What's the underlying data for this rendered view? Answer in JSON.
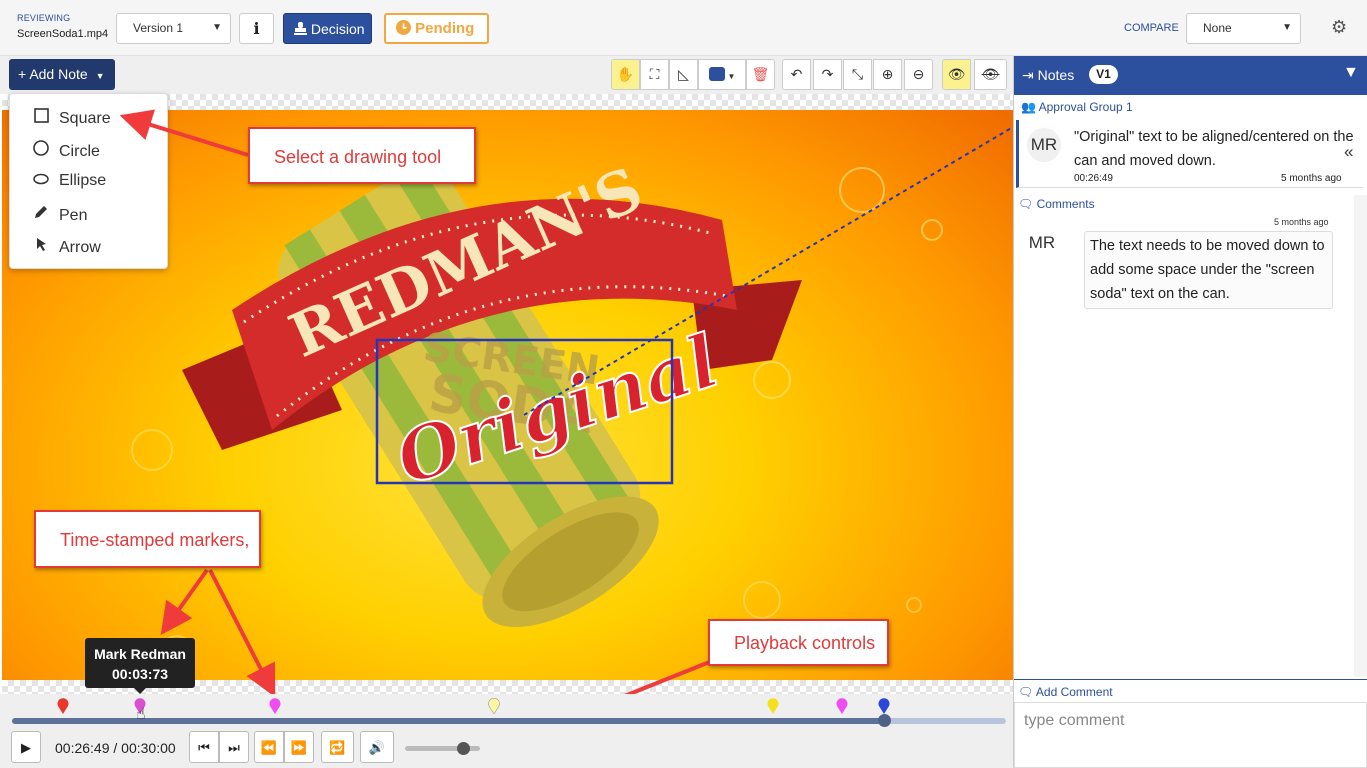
{
  "header": {
    "reviewing_label": "REVIEWING",
    "filename": "ScreenSoda1.mp4",
    "version_select": "Version 1",
    "info_label": "i",
    "decision_label": "Decision",
    "pending_label": "Pending",
    "compare_label": "COMPARE",
    "compare_select": "None"
  },
  "toolbar": {
    "add_note_label": "Add Note",
    "tools": [
      {
        "name": "pan-tool-button",
        "icon": "hand-icon",
        "active": true
      },
      {
        "name": "crop-tool-button",
        "icon": "crop-icon",
        "active": false
      },
      {
        "name": "measure-tool-button",
        "icon": "ruler-icon",
        "active": false
      },
      {
        "name": "color-picker-button",
        "icon": "palette-icon",
        "active": false
      },
      {
        "name": "delete-button",
        "icon": "trash-icon",
        "active": false
      },
      {
        "name": "undo-button",
        "icon": "undo-icon",
        "active": false
      },
      {
        "name": "redo-button",
        "icon": "redo-icon",
        "active": false
      },
      {
        "name": "fit-button",
        "icon": "expand-icon",
        "active": false
      },
      {
        "name": "zoom-in-button",
        "icon": "zoom-in-icon",
        "active": false
      },
      {
        "name": "zoom-out-button",
        "icon": "zoom-out-icon",
        "active": false
      },
      {
        "name": "show-annotations-button",
        "icon": "eye-icon",
        "active": true
      },
      {
        "name": "hide-annotations-button",
        "icon": "eye-off-icon",
        "active": false
      }
    ]
  },
  "draw_menu": {
    "items": [
      {
        "label": "Square",
        "icon": "square-icon"
      },
      {
        "label": "Circle",
        "icon": "circle-icon"
      },
      {
        "label": "Ellipse",
        "icon": "ellipse-icon"
      },
      {
        "label": "Pen",
        "icon": "pen-icon"
      },
      {
        "label": "Arrow",
        "icon": "cursor-arrow-icon"
      }
    ]
  },
  "video": {
    "brand_text": "REDMAN'S",
    "can_text_1": "SCREEN",
    "can_text_2": "SODA",
    "script_text": "Original"
  },
  "callouts": {
    "drawing_tool": "Select a drawing tool",
    "markers": "Time-stamped markers,",
    "playback": "Playback controls"
  },
  "tooltip": {
    "name": "Mark Redman",
    "time": "00:03:73"
  },
  "timeline": {
    "progress_fraction": 0.877,
    "markers": [
      {
        "color": "#e8382d"
      },
      {
        "color": "#d84fd0"
      },
      {
        "color": "#f04df0"
      },
      {
        "color": "#fff7a0"
      },
      {
        "color": "#f5e020"
      },
      {
        "color": "#f04df0"
      },
      {
        "color": "#2a47d8"
      }
    ]
  },
  "playback": {
    "timecode": "00:26:49 / 00:30:00",
    "volume_fraction": 0.78
  },
  "notes_panel": {
    "title": "Notes",
    "version_badge": "V1",
    "group_label": "Approval Group 1",
    "note": {
      "avatar": "MR",
      "text": "\"Original\" text to be aligned/centered on the can and moved down.",
      "timestamp": "00:26:49",
      "ago": "5 months ago"
    },
    "comments_label": "Comments",
    "comment": {
      "ago": "5 months ago",
      "avatar": "MR",
      "text": "The text needs to be moved down to add some space under the \"screen soda\" text on the can."
    },
    "add_comment_label": "Add Comment",
    "comment_placeholder": "type comment"
  }
}
